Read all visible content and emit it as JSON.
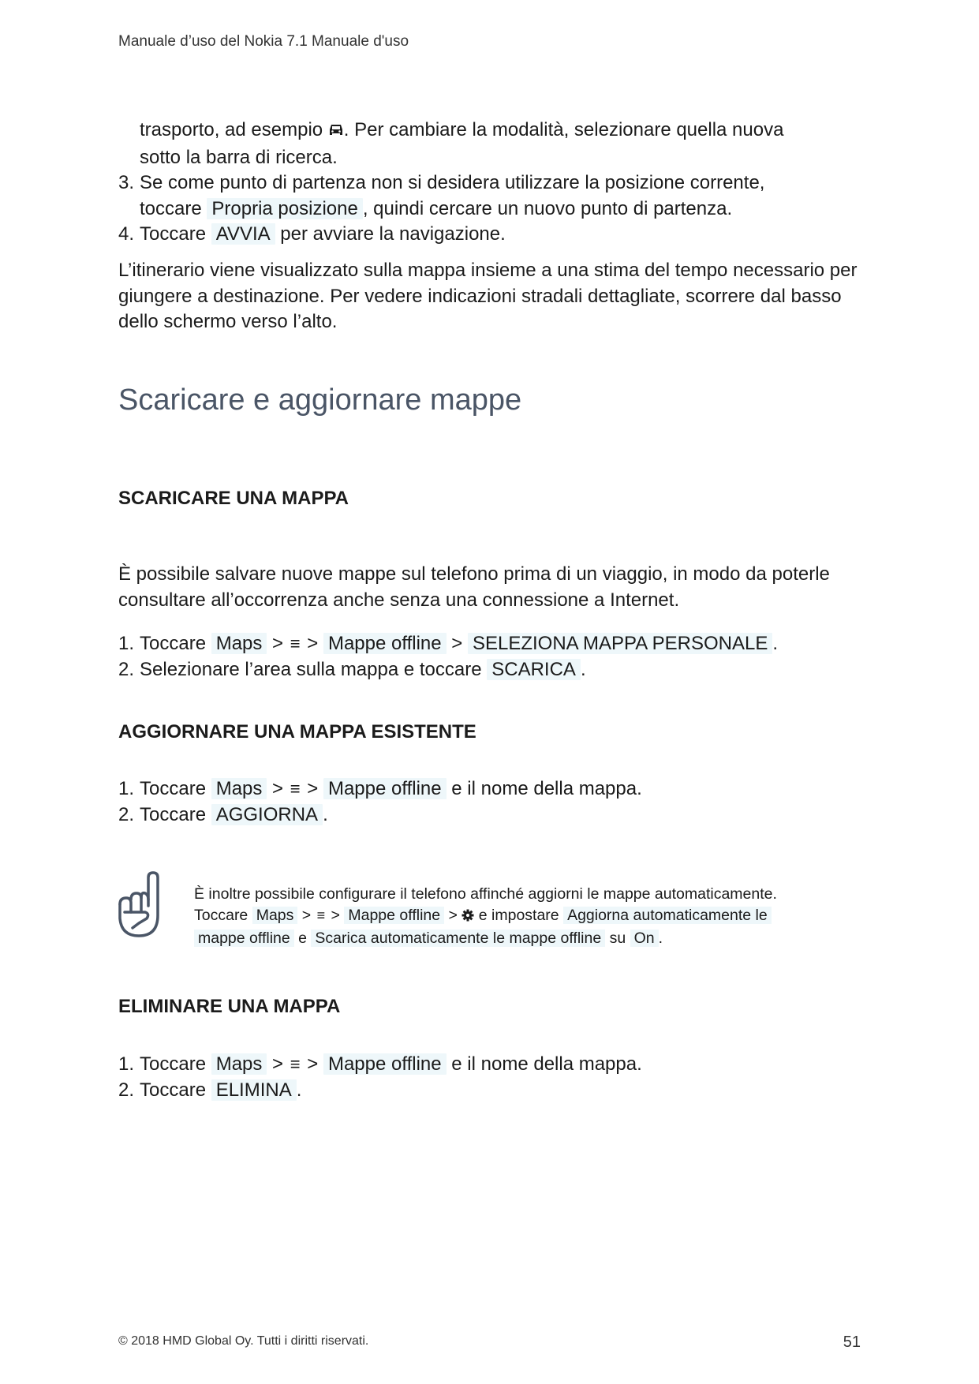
{
  "header": {
    "title": "Manuale d’uso del Nokia 7.1 Manuale d'uso"
  },
  "intro_list": {
    "item2_cont_a": "trasporto, ad esempio ",
    "item2_icon": "car-icon",
    "item2_cont_b": ". Per cambiare la modalità, selezionare quella nuova",
    "item2_cont_c": "sotto la barra di ricerca.",
    "item3_num": "3.",
    "item3_a": "Se come punto di partenza non si desidera utilizzare la posizione corrente,",
    "item3_b": "toccare ",
    "item3_hl": "Propria posizione",
    "item3_c": ", quindi cercare un nuovo punto di partenza.",
    "item4_num": "4.",
    "item4_a": "Toccare ",
    "item4_hl": "AVVIA",
    "item4_b": " per avviare la navigazione."
  },
  "route_paragraph": "L’itinerario viene visualizzato sulla mappa insieme a una stima del tempo necessario per giungere a destinazione. Per vedere indicazioni stradali dettagliate, scorrere dal basso dello schermo verso l’alto.",
  "section_title": "Scaricare e aggiornare mappe",
  "download": {
    "heading": "SCARICARE UNA MAPPA",
    "intro": "È possibile salvare nuove mappe sul telefono prima di un viaggio, in modo da poterle consultare all’occorrenza anche senza una connessione a Internet.",
    "step1_num": "1.",
    "step1_a": "Toccare ",
    "step1_maps": "Maps",
    "sep": " > ",
    "menu_glyph": "≡",
    "step1_offline": "Mappe offline",
    "step1_select": "SELEZIONA MAPPA PERSONALE",
    "dot": ".",
    "step2_num": "2.",
    "step2_a": "Selezionare l’area sulla mappa e toccare ",
    "step2_hl": "SCARICA"
  },
  "update": {
    "heading": "AGGIORNARE UNA MAPPA ESISTENTE",
    "step1_num": "1.",
    "step1_a": "Toccare ",
    "step1_maps": "Maps",
    "step1_offline": "Mappe offline",
    "step1_tail": " e il nome della mappa.",
    "step2_num": "2.",
    "step2_a": "Toccare ",
    "step2_hl": "AGGIORNA"
  },
  "tip": {
    "icon": "pointing-hand-icon",
    "line1": "È inoltre possibile configurare il telefono affinché aggiorni le mappe automaticamente.",
    "toccare": "Toccare ",
    "maps": "Maps",
    "offline": "Mappe offline",
    "gear": "gear-icon",
    "impostare": " e impostare ",
    "auto_update_a": "Aggiorna automaticamente le",
    "auto_update_b": "mappe offline",
    "e": " e ",
    "auto_download": "Scarica automaticamente le mappe offline",
    "su": " su ",
    "on": "On"
  },
  "delete": {
    "heading": "ELIMINARE UNA MAPPA",
    "step1_num": "1.",
    "step1_a": "Toccare ",
    "step1_maps": "Maps",
    "step1_offline": "Mappe offline",
    "step1_tail": " e il nome della mappa.",
    "step2_num": "2.",
    "step2_a": "Toccare ",
    "step2_hl": "ELIMINA"
  },
  "footer": {
    "copyright": "© 2018 HMD Global Oy. Tutti i diritti riservati.",
    "page_number": "51"
  },
  "colors": {
    "highlight_bg": "#eef7fa",
    "section_title": "#4a5566",
    "icon_stroke": "#4a5566"
  }
}
